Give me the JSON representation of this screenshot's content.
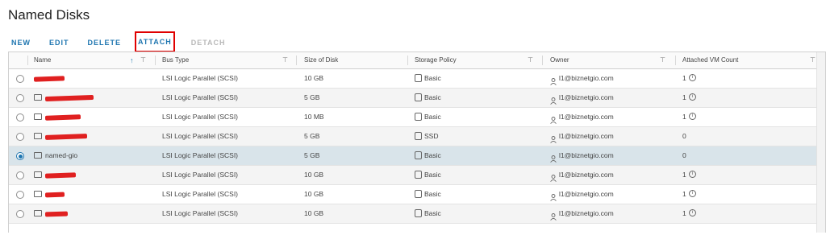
{
  "page": {
    "title": "Named Disks"
  },
  "toolbar": {
    "new": "NEW",
    "edit": "EDIT",
    "delete": "DELETE",
    "attach": "ATTACH",
    "detach": "DETACH"
  },
  "columns": {
    "name": "Name",
    "bus_type": "Bus Type",
    "size": "Size of Disk",
    "policy": "Storage Policy",
    "owner": "Owner",
    "vm_count": "Attached VM Count"
  },
  "colors": {
    "accent": "#1f76b0",
    "highlight": "#e00000",
    "redaction": "#e02020",
    "selected_row": "#d9e4ea"
  },
  "rows": [
    {
      "name": "",
      "redacted": true,
      "bus_type": "LSI Logic Parallel (SCSI)",
      "size": "10 GB",
      "policy": "Basic",
      "owner": "l1@biznetgio.com",
      "vm_count": "1",
      "selected": false
    },
    {
      "name": "",
      "redacted": true,
      "bus_type": "LSI Logic Parallel (SCSI)",
      "size": "5 GB",
      "policy": "Basic",
      "owner": "l1@biznetgio.com",
      "vm_count": "1",
      "selected": false
    },
    {
      "name": "",
      "redacted": true,
      "bus_type": "LSI Logic Parallel (SCSI)",
      "size": "10 MB",
      "policy": "Basic",
      "owner": "l1@biznetgio.com",
      "vm_count": "1",
      "selected": false
    },
    {
      "name": "",
      "redacted": true,
      "bus_type": "LSI Logic Parallel (SCSI)",
      "size": "5 GB",
      "policy": "SSD",
      "owner": "l1@biznetgio.com",
      "vm_count": "0",
      "selected": false
    },
    {
      "name": "named-gio",
      "redacted": false,
      "bus_type": "LSI Logic Parallel (SCSI)",
      "size": "5 GB",
      "policy": "Basic",
      "owner": "l1@biznetgio.com",
      "vm_count": "0",
      "selected": true
    },
    {
      "name": "",
      "redacted": true,
      "bus_type": "LSI Logic Parallel (SCSI)",
      "size": "10 GB",
      "policy": "Basic",
      "owner": "l1@biznetgio.com",
      "vm_count": "1",
      "selected": false
    },
    {
      "name": "",
      "redacted": true,
      "bus_type": "LSI Logic Parallel (SCSI)",
      "size": "10 GB",
      "policy": "Basic",
      "owner": "l1@biznetgio.com",
      "vm_count": "1",
      "selected": false
    },
    {
      "name": "",
      "redacted": true,
      "bus_type": "LSI Logic Parallel (SCSI)",
      "size": "10 GB",
      "policy": "Basic",
      "owner": "l1@biznetgio.com",
      "vm_count": "1",
      "selected": false
    }
  ]
}
